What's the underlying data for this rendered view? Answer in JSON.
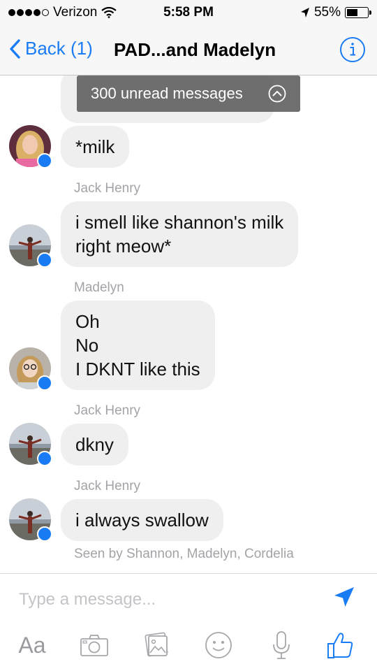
{
  "status_bar": {
    "carrier": "Verizon",
    "time": "5:58 PM",
    "battery": "55%",
    "battery_level": 0.55,
    "icons": [
      "signal-dots-icon",
      "wifi-icon",
      "location-arrow-icon",
      "battery-icon"
    ]
  },
  "nav": {
    "back_label": "Back (1)",
    "title": "PAD...and Madelyn",
    "info_icon": "info-icon"
  },
  "unread_banner": {
    "label": "300 unread messages",
    "icon": "chevron-up-circle-icon"
  },
  "messages": [
    {
      "sender": "",
      "lines": [
        "*milk"
      ],
      "avatar": "avatar-girl-blonde"
    },
    {
      "sender": "Jack Henry",
      "lines": [
        "i smell like shannon's milk",
        "right meow*"
      ],
      "avatar": "avatar-jack-henry"
    },
    {
      "sender": "Madelyn",
      "lines": [
        "Oh",
        "No",
        "I DKNT like this"
      ],
      "avatar": "avatar-madelyn"
    },
    {
      "sender": "Jack Henry",
      "lines": [
        "dkny"
      ],
      "avatar": "avatar-jack-henry"
    },
    {
      "sender": "Jack Henry",
      "lines": [
        "i always swallow"
      ],
      "avatar": "avatar-jack-henry"
    }
  ],
  "seen_by": "Seen by Shannon, Madelyn, Cordelia",
  "compose": {
    "placeholder": "Type a message...",
    "send_icon": "send-arrow-icon",
    "tools": [
      {
        "name": "text-style",
        "label": "Aa"
      },
      {
        "name": "camera",
        "icon": "camera-icon"
      },
      {
        "name": "photos",
        "icon": "photos-icon"
      },
      {
        "name": "emoji",
        "icon": "smiley-icon"
      },
      {
        "name": "microphone",
        "icon": "microphone-icon"
      },
      {
        "name": "like",
        "icon": "thumbs-up-icon"
      }
    ]
  },
  "colors": {
    "accent": "#1a7cf5",
    "bubble": "#efeff0",
    "meta_text": "#a3a3a8",
    "bar_bg": "#f7f7f7"
  }
}
